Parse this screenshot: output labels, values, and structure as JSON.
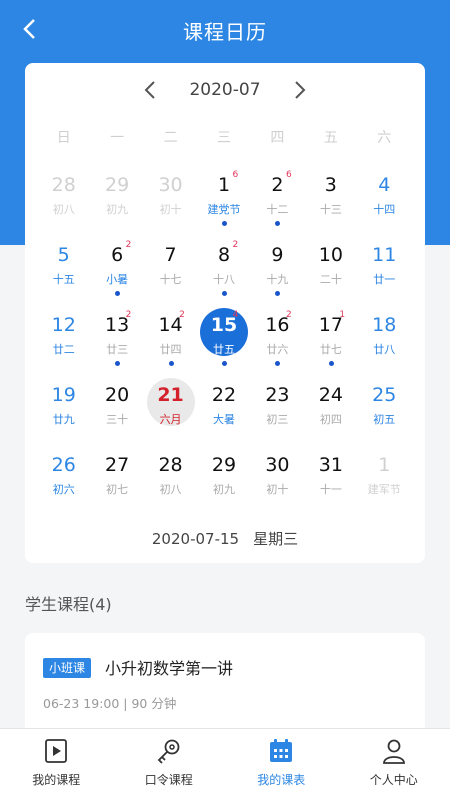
{
  "header": {
    "title": "课程日历"
  },
  "calendar": {
    "month": "2020-07",
    "weekdays": [
      "日",
      "一",
      "二",
      "三",
      "四",
      "五",
      "六"
    ],
    "days": [
      {
        "num": "28",
        "sub": "初八",
        "other": true
      },
      {
        "num": "29",
        "sub": "初九",
        "other": true
      },
      {
        "num": "30",
        "sub": "初十",
        "other": true
      },
      {
        "num": "1",
        "sub": "建党节",
        "badge": "6",
        "dot": true,
        "term": true
      },
      {
        "num": "2",
        "sub": "十二",
        "badge": "6",
        "dot": true
      },
      {
        "num": "3",
        "sub": "十三"
      },
      {
        "num": "4",
        "sub": "十四",
        "weekend": true
      },
      {
        "num": "5",
        "sub": "十五",
        "weekend": true
      },
      {
        "num": "6",
        "sub": "小暑",
        "badge": "2",
        "dot": true,
        "term": true
      },
      {
        "num": "7",
        "sub": "十七"
      },
      {
        "num": "8",
        "sub": "十八",
        "badge": "2",
        "dot": true
      },
      {
        "num": "9",
        "sub": "十九",
        "dot": true
      },
      {
        "num": "10",
        "sub": "二十"
      },
      {
        "num": "11",
        "sub": "廿一",
        "weekend": true
      },
      {
        "num": "12",
        "sub": "廿二",
        "weekend": true
      },
      {
        "num": "13",
        "sub": "廿三",
        "badge": "2",
        "dot": true
      },
      {
        "num": "14",
        "sub": "廿四",
        "badge": "2",
        "dot": true
      },
      {
        "num": "15",
        "sub": "廿五",
        "badge": "4",
        "dot": true,
        "selected": true
      },
      {
        "num": "16",
        "sub": "廿六",
        "badge": "2",
        "dot": true
      },
      {
        "num": "17",
        "sub": "廿七",
        "badge": "1",
        "dot": true
      },
      {
        "num": "18",
        "sub": "廿八",
        "weekend": true
      },
      {
        "num": "19",
        "sub": "廿九",
        "weekend": true
      },
      {
        "num": "20",
        "sub": "三十"
      },
      {
        "num": "21",
        "sub": "六月",
        "today": true
      },
      {
        "num": "22",
        "sub": "大暑",
        "term": true
      },
      {
        "num": "23",
        "sub": "初三"
      },
      {
        "num": "24",
        "sub": "初四"
      },
      {
        "num": "25",
        "sub": "初五",
        "weekend": true
      },
      {
        "num": "26",
        "sub": "初六",
        "weekend": true
      },
      {
        "num": "27",
        "sub": "初七"
      },
      {
        "num": "28",
        "sub": "初八"
      },
      {
        "num": "29",
        "sub": "初九"
      },
      {
        "num": "30",
        "sub": "初十"
      },
      {
        "num": "31",
        "sub": "十一"
      },
      {
        "num": "1",
        "sub": "建军节",
        "other": true
      }
    ],
    "selected_date": "2020-07-15",
    "selected_weekday": "星期三"
  },
  "courses": {
    "section_title": "学生课程(4)",
    "items": [
      {
        "tag": "小班课",
        "name": "小升初数学第一讲",
        "meta": "06-23   19:00 | 90 分钟"
      }
    ]
  },
  "tabbar": {
    "tabs": [
      {
        "label": "我的课程",
        "icon": "video-icon",
        "active": false
      },
      {
        "label": "口令课程",
        "icon": "key-icon",
        "active": false
      },
      {
        "label": "我的课表",
        "icon": "calendar-icon",
        "active": true
      },
      {
        "label": "个人中心",
        "icon": "user-icon",
        "active": false
      }
    ]
  },
  "colors": {
    "primary": "#2d86e3",
    "badge": "#e0355a",
    "today": "#d3212c"
  }
}
